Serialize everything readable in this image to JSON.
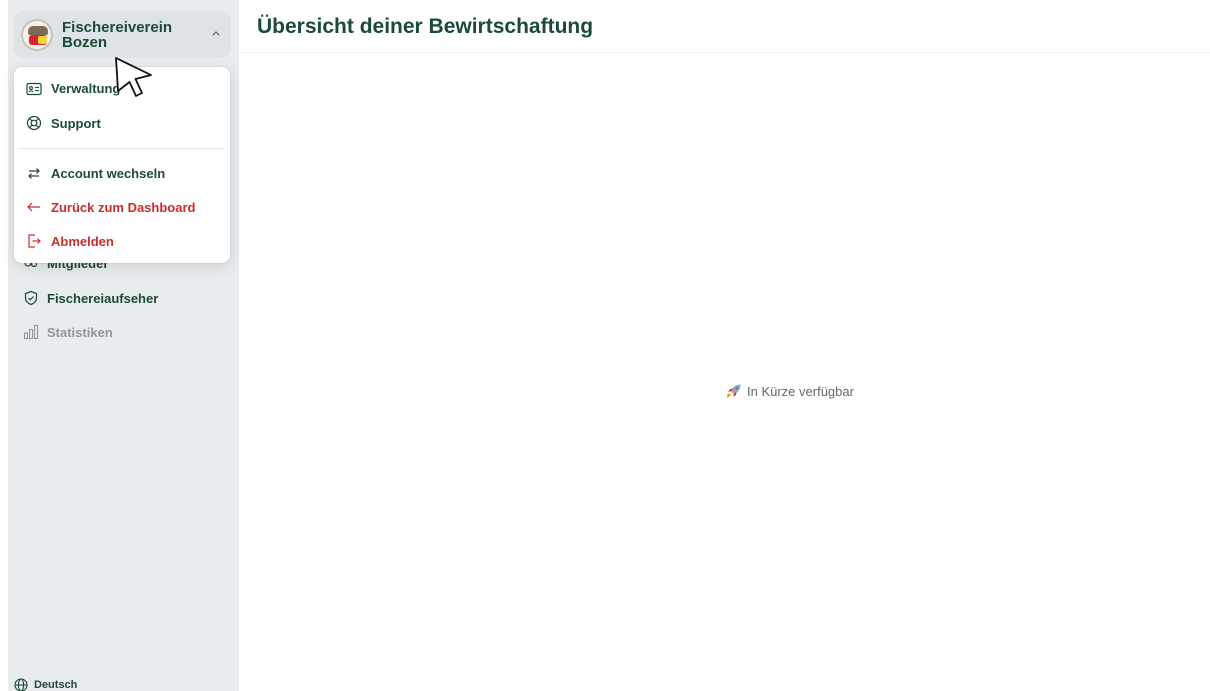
{
  "header": {
    "title": "Übersicht deiner Bewirtschaftung"
  },
  "org": {
    "name": "Fischereiverein Bozen"
  },
  "menu": {
    "items": [
      {
        "label": "Verwaltung",
        "icon": "id-card-icon"
      },
      {
        "label": "Support",
        "icon": "lifebuoy-icon"
      },
      {
        "label": "Account wechseln",
        "icon": "swap-arrows-icon"
      },
      {
        "label": "Zurück zum Dashboard",
        "icon": "arrow-left-icon"
      },
      {
        "label": "Abmelden",
        "icon": "logout-icon"
      }
    ]
  },
  "sidebar": {
    "items": [
      {
        "label": "Mitglieder",
        "icon": "members-icon"
      },
      {
        "label": "Fischereiaufseher",
        "icon": "shield-check-icon"
      },
      {
        "label": "Statistiken",
        "icon": "bar-chart-icon",
        "disabled": true
      }
    ],
    "language": "Deutsch"
  },
  "main": {
    "placeholder": "In Kürze verfügbar",
    "placeholder_icon": "rocket-icon"
  },
  "colors": {
    "brand": "#1d4a36",
    "danger": "#c92d2a",
    "sidebar_bg": "#e8ecef",
    "muted": "#8b989e"
  }
}
